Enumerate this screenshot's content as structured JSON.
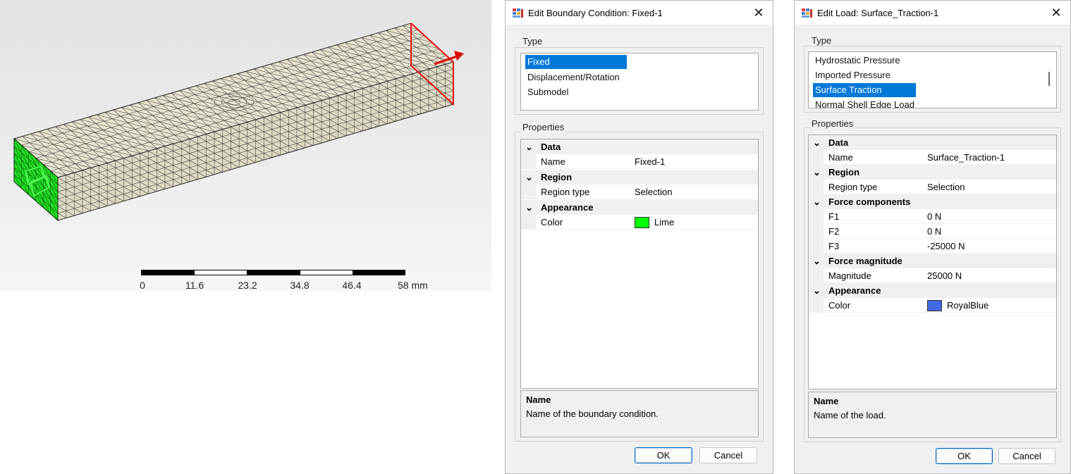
{
  "viewport": {
    "scale_bar": {
      "ticks": [
        "0",
        "11.6",
        "23.2",
        "34.8",
        "46.4",
        "58 mm"
      ]
    },
    "colors": {
      "fixed_face": "#22dd22",
      "load_face": "#ee1111",
      "mesh_fill": "#e6e3cf"
    }
  },
  "dialog_bc": {
    "title": "Edit Boundary Condition: Fixed-1",
    "type_group_label": "Type",
    "type_items": [
      "Fixed",
      "Displacement/Rotation",
      "Submodel"
    ],
    "selected_type": "Fixed",
    "properties_group_label": "Properties",
    "categories": {
      "data": "Data",
      "region": "Region",
      "appearance": "Appearance"
    },
    "props": {
      "name_label": "Name",
      "name_value": "Fixed-1",
      "region_type_label": "Region type",
      "region_type_value": "Selection",
      "color_label": "Color",
      "color_value": "Lime",
      "color_hex": "#00ff00"
    },
    "description": {
      "title": "Name",
      "text": "Name of the boundary condition."
    },
    "ok_label": "OK",
    "cancel_label": "Cancel"
  },
  "dialog_load": {
    "title": "Edit Load: Surface_Traction-1",
    "type_group_label": "Type",
    "type_items": [
      "Hydrostatic Pressure",
      "Imported Pressure",
      "Surface Traction",
      "Normal Shell Edge Load"
    ],
    "selected_type": "Surface Traction",
    "properties_group_label": "Properties",
    "categories": {
      "data": "Data",
      "region": "Region",
      "force_components": "Force components",
      "force_magnitude": "Force magnitude",
      "appearance": "Appearance"
    },
    "props": {
      "name_label": "Name",
      "name_value": "Surface_Traction-1",
      "region_type_label": "Region type",
      "region_type_value": "Selection",
      "f1_label": "F1",
      "f1_value": "0 N",
      "f2_label": "F2",
      "f2_value": "0 N",
      "f3_label": "F3",
      "f3_value": "-25000 N",
      "magnitude_label": "Magnitude",
      "magnitude_value": "25000 N",
      "color_label": "Color",
      "color_value": "RoyalBlue",
      "color_hex": "#4169e1"
    },
    "description": {
      "title": "Name",
      "text": "Name of the load."
    },
    "ok_label": "OK",
    "cancel_label": "Cancel"
  }
}
